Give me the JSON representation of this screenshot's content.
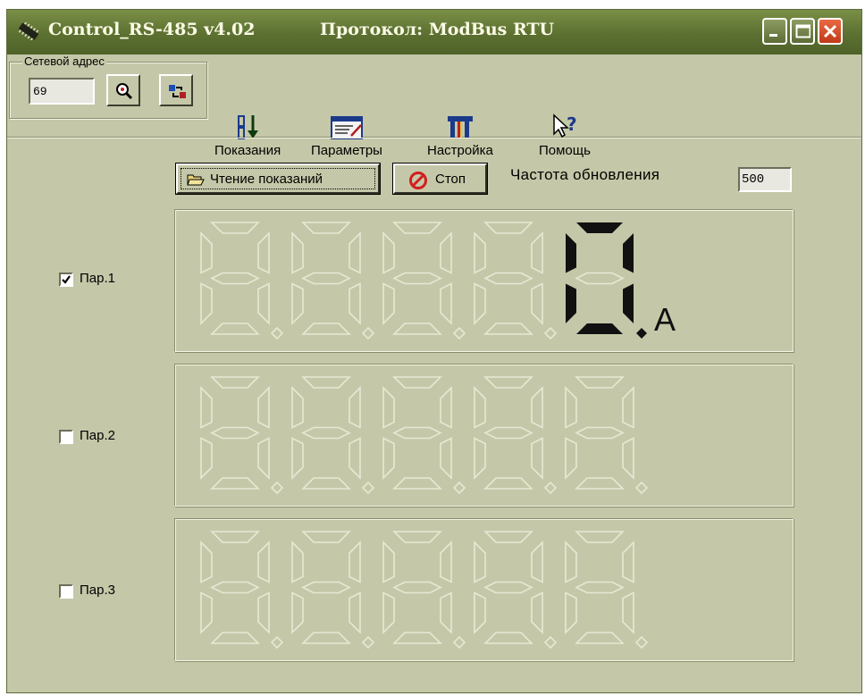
{
  "window": {
    "title": "Control_RS-485 v4.02",
    "protocol": "Протокол: ModBus RTU"
  },
  "toolbar": {
    "network_group_label": "Сетевой адрес",
    "network_address": "69",
    "search_icon": "magnifier-icon",
    "connect_icon": "transfer-icon",
    "items": [
      {
        "label": "Показания",
        "icon": "readings-icon"
      },
      {
        "label": "Параметры",
        "icon": "parameters-icon"
      },
      {
        "label": "Настройка",
        "icon": "settings-tools-icon"
      },
      {
        "label": "Помощь",
        "icon": "help-pointer-icon"
      }
    ]
  },
  "controls": {
    "read_button": "Чтение показаний",
    "stop_button": "Стоп",
    "refresh_rate_label": "Частота обновления",
    "refresh_rate_value": "500"
  },
  "displays": [
    {
      "label": "Пар.1",
      "checked": true,
      "value": "0",
      "unit": "A"
    },
    {
      "label": "Пар.2",
      "checked": false,
      "value": "",
      "unit": ""
    },
    {
      "label": "Пар.3",
      "checked": false,
      "value": "",
      "unit": ""
    }
  ],
  "colors": {
    "background": "#c5c8a8",
    "title_bar": "#5c7031",
    "segment_off": "#e6e8d4",
    "segment_on": "#111111"
  }
}
